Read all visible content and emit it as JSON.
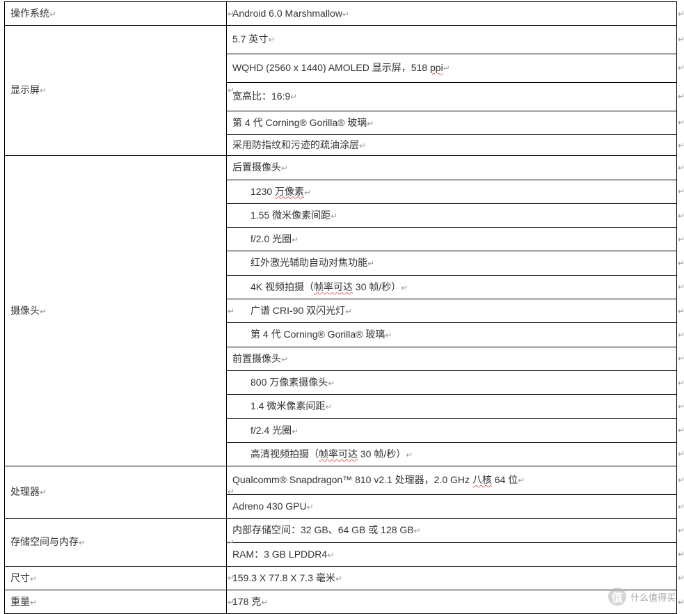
{
  "marks": {
    "para": "↵",
    "cell_end": "↵"
  },
  "rows": [
    {
      "label": "操作系统",
      "values": [
        "Android 6.0 Marshmallow"
      ],
      "heights": [
        "row"
      ]
    },
    {
      "label": "显示屏",
      "values": [
        "5.7 英寸",
        "WQHD (2560 x 1440) AMOLED 显示屏，518 ppi",
        "宽高比：16:9",
        "第 4 代 Corning® Gorilla® 玻璃",
        "采用防指纹和污迹的疏油涂层"
      ],
      "heights": [
        "row-tall",
        "row-tall",
        "row-tall",
        "row",
        "row-short"
      ],
      "squiggle_idx": [
        1
      ]
    },
    {
      "label": "摄像头",
      "values": [
        {
          "text": "后置摄像头",
          "indent": false
        },
        {
          "text": "1230 万像素",
          "indent": true,
          "squiggle_word": "万像素"
        },
        {
          "text": "1.55 微米像素间距",
          "indent": true
        },
        {
          "text": "f/2.0 光圈",
          "indent": true
        },
        {
          "text": "红外激光辅助自动对焦功能",
          "indent": true
        },
        {
          "text": "4K 视频拍摄（帧率可达 30 帧/秒）",
          "indent": true,
          "squiggle_word": "帧率可达"
        },
        {
          "text": "广谱 CRI-90 双闪光灯",
          "indent": true
        },
        {
          "text": "第 4 代 Corning® Gorilla® 玻璃",
          "indent": true
        },
        {
          "text": "前置摄像头",
          "indent": false
        },
        {
          "text": "800 万像素摄像头",
          "indent": true
        },
        {
          "text": "1.4 微米像素间距",
          "indent": true
        },
        {
          "text": "f/2.4 光圈",
          "indent": true
        },
        {
          "text": "高清视频拍摄（帧率可达 30 帧/秒）",
          "indent": true,
          "squiggle_word": "帧率可达"
        }
      ],
      "heights": [
        "row",
        "row",
        "row",
        "row",
        "row",
        "row",
        "row",
        "row",
        "row",
        "row",
        "row",
        "row",
        "row"
      ]
    },
    {
      "label": "处理器",
      "values": [
        "Qualcomm® Snapdragon™ 810 v2.1 处理器，2.0 GHz 八核 64 位",
        "Adreno 430 GPU"
      ],
      "heights": [
        "row-tall",
        "row"
      ],
      "squiggle_idx": [
        0
      ]
    },
    {
      "label": "存储空间与内存",
      "values": [
        "内部存储空间：32 GB、64 GB 或 128 GB",
        "RAM：3 GB LPDDR4"
      ],
      "heights": [
        "row",
        "row"
      ]
    },
    {
      "label": "尺寸",
      "values": [
        "159.3 X 77.8 X 7.3 毫米"
      ],
      "heights": [
        "row"
      ]
    },
    {
      "label": "重量",
      "values": [
        "178 克"
      ],
      "heights": [
        "row"
      ]
    }
  ],
  "watermark": "什么值得买"
}
